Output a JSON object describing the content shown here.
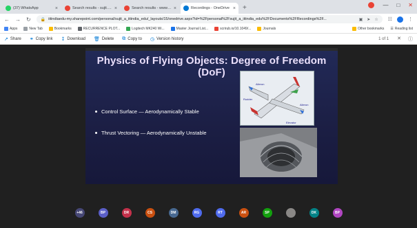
{
  "tabs": [
    {
      "label": "(37) WhatsApp",
      "color": "#25d366",
      "active": false
    },
    {
      "label": "Search results - sujit.a@iitindia.e",
      "color": "#ea4335",
      "active": false
    },
    {
      "label": "Search results - www-iit-ab@iitm",
      "color": "#ea4335",
      "active": false
    },
    {
      "label": "Recordings - OneDrive",
      "color": "#0078d4",
      "active": true
    }
  ],
  "address": {
    "url": "iitindiaedu-my.sharepoint.com/personal/sujit_a_iitindia_edu/_layouts/15/onedrive.aspx?id=%2Fpersonal%2Fsujit_a_iitindia_edu%2FDocuments%2FRecordings%2F..."
  },
  "bookmarks": [
    {
      "label": "Apps",
      "color": "#4285f4"
    },
    {
      "label": "New Tab",
      "color": "#9aa0a6"
    },
    {
      "label": "Bookmarks",
      "color": "#fbbc04"
    },
    {
      "label": "RECURRENCE PLOT...",
      "color": "#5f6368"
    },
    {
      "label": "Logitech MK240 Wi...",
      "color": "#34a853"
    },
    {
      "label": "Master Journal List...",
      "color": "#1a73e8"
    },
    {
      "label": "scrirub.io/10.1049/...",
      "color": "#ea4335"
    },
    {
      "label": "Journals",
      "color": "#fbbc04"
    }
  ],
  "bookmarks_right": {
    "other": "Other bookmarks",
    "reading": "Reading list"
  },
  "toolbar": {
    "share": "Share",
    "copy_link": "Copy link",
    "download": "Download",
    "delete": "Delete",
    "copy_to": "Copy to",
    "version_history": "Version history",
    "page_count": "1 of 1"
  },
  "slide": {
    "title": "Physics of Flying Objects: Degree of Freedom (DoF)",
    "bullets": [
      "Control Surface — Aerodynamically Stable",
      "Thrust Vectoring — Aerodynamically Unstable"
    ],
    "labels": {
      "aileron1": "Aileron",
      "rudder": "Rudder",
      "aileron2": "Aileron",
      "elevator": "Elevator"
    }
  },
  "participants": [
    {
      "initials": "+46",
      "color": "#464775"
    },
    {
      "initials": "BP",
      "color": "#5b5fc7"
    },
    {
      "initials": "DR",
      "color": "#c4314b"
    },
    {
      "initials": "CS",
      "color": "#ca5010"
    },
    {
      "initials": "DM",
      "color": "#486991"
    },
    {
      "initials": "RG",
      "color": "#4f6bed"
    },
    {
      "initials": "RT",
      "color": "#4f6bed"
    },
    {
      "initials": "AR",
      "color": "#ca5010"
    },
    {
      "initials": "SP",
      "color": "#13a10e"
    },
    {
      "initials": "",
      "color": "#8a8886"
    },
    {
      "initials": "DK",
      "color": "#038387"
    },
    {
      "initials": "BP",
      "color": "#b146c2"
    }
  ]
}
